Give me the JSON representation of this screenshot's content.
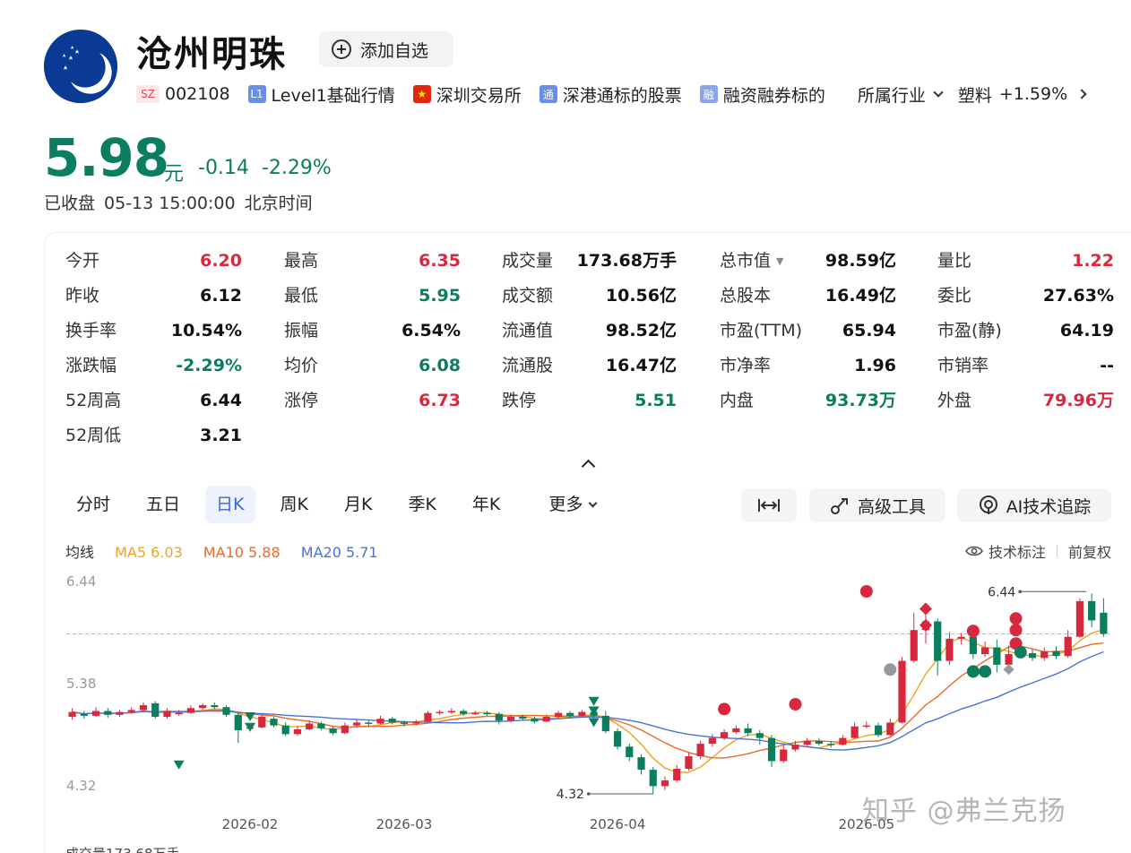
{
  "header": {
    "stock_name": "沧州明珠",
    "add_watchlist_label": "添加自选",
    "exchange_code": "SZ",
    "stock_code": "002108",
    "level_badge": "L1",
    "level_label": "Level1基础行情",
    "exchange_label": "深圳交易所",
    "connect_badge": "通",
    "connect_label": "深港通标的股票",
    "margin_badge": "融",
    "margin_label": "融资融券标的",
    "industry_label": "所属行业",
    "industry_name": "塑料",
    "industry_change": "+1.59%"
  },
  "price": {
    "current": "5.98",
    "unit": "元",
    "change": "-0.14",
    "change_pct": "-2.29%",
    "status": "已收盘",
    "datetime": "05-13 15:00:00",
    "timezone": "北京时间"
  },
  "quote_columns": [
    [
      {
        "label": "今开",
        "value": "6.20",
        "color": "up"
      },
      {
        "label": "昨收",
        "value": "6.12",
        "color": "neutral"
      },
      {
        "label": "换手率",
        "value": "10.54%",
        "color": "neutral"
      },
      {
        "label": "涨跌幅",
        "value": "-2.29%",
        "color": "down"
      },
      {
        "label": "52周高",
        "value": "6.44",
        "color": "neutral"
      },
      {
        "label": "52周低",
        "value": "3.21",
        "color": "neutral"
      }
    ],
    [
      {
        "label": "最高",
        "value": "6.35",
        "color": "up"
      },
      {
        "label": "最低",
        "value": "5.95",
        "color": "down"
      },
      {
        "label": "振幅",
        "value": "6.54%",
        "color": "neutral"
      },
      {
        "label": "均价",
        "value": "6.08",
        "color": "down"
      },
      {
        "label": "涨停",
        "value": "6.73",
        "color": "up"
      }
    ],
    [
      {
        "label": "成交量",
        "value": "173.68万手",
        "color": "neutral"
      },
      {
        "label": "成交额",
        "value": "10.56亿",
        "color": "neutral"
      },
      {
        "label": "流通值",
        "value": "98.52亿",
        "color": "neutral"
      },
      {
        "label": "流通股",
        "value": "16.47亿",
        "color": "neutral"
      },
      {
        "label": "跌停",
        "value": "5.51",
        "color": "down"
      }
    ],
    [
      {
        "label": "总市值",
        "value": "98.59亿",
        "color": "neutral",
        "triangle": true
      },
      {
        "label": "总股本",
        "value": "16.49亿",
        "color": "neutral"
      },
      {
        "label": "市盈(TTM)",
        "value": "65.94",
        "color": "neutral"
      },
      {
        "label": "市净率",
        "value": "1.96",
        "color": "neutral"
      },
      {
        "label": "内盘",
        "value": "93.73万",
        "color": "down"
      }
    ],
    [
      {
        "label": "量比",
        "value": "1.22",
        "color": "up"
      },
      {
        "label": "委比",
        "value": "27.63%",
        "color": "neutral"
      },
      {
        "label": "市盈(静)",
        "value": "64.19",
        "color": "neutral"
      },
      {
        "label": "市销率",
        "value": "--",
        "color": "neutral"
      },
      {
        "label": "外盘",
        "value": "79.96万",
        "color": "up"
      }
    ]
  ],
  "chart_tabs": {
    "items": [
      "分时",
      "五日",
      "日K",
      "周K",
      "月K",
      "季K",
      "年K"
    ],
    "active": "日K",
    "more_label": "更多"
  },
  "tools": {
    "advanced_label": "高级工具",
    "ai_label": "AI技术追踪"
  },
  "ma_legend": {
    "title": "均线",
    "ma5": "MA5 6.03",
    "ma10": "MA10 5.88",
    "ma20": "MA20 5.71"
  },
  "chart_tools": {
    "indicator_label": "技术标注",
    "adjust_label": "前复权"
  },
  "colors": {
    "up": "#d8283e",
    "down": "#0a7e5e",
    "accent": "#3966d8",
    "ma5": "#f0a31f",
    "ma10": "#ea6a27",
    "ma20": "#4b73d6"
  },
  "kline": {
    "y_ticks": [
      "6.44",
      "5.38",
      "4.32"
    ],
    "x_labels": [
      "2026-02",
      "2026-03",
      "2026-04",
      "2026-05"
    ],
    "high_marker": "6.44",
    "low_marker": "4.32",
    "ref_price": 5.98,
    "candles": [
      [
        5.12,
        5.17,
        5.21,
        5.09
      ],
      [
        5.15,
        5.13,
        5.18,
        5.1
      ],
      [
        5.13,
        5.18,
        5.22,
        5.12
      ],
      [
        5.18,
        5.14,
        5.21,
        5.11
      ],
      [
        5.14,
        5.17,
        5.19,
        5.12
      ],
      [
        5.17,
        5.19,
        5.22,
        5.15
      ],
      [
        5.19,
        5.24,
        5.27,
        5.17
      ],
      [
        5.26,
        5.12,
        5.28,
        5.1
      ],
      [
        5.12,
        5.18,
        5.21,
        5.1
      ],
      [
        5.16,
        5.16,
        5.19,
        5.13
      ],
      [
        5.16,
        5.21,
        5.24,
        5.15
      ],
      [
        5.21,
        5.24,
        5.26,
        5.19
      ],
      [
        5.24,
        5.22,
        5.27,
        5.2
      ],
      [
        5.22,
        5.14,
        5.24,
        5.12
      ],
      [
        5.14,
        4.98,
        5.16,
        4.85
      ],
      [
        5.0,
        5.01,
        5.04,
        4.97
      ],
      [
        5.01,
        5.12,
        5.15,
        5.0
      ],
      [
        5.1,
        5.03,
        5.12,
        5.01
      ],
      [
        5.03,
        4.94,
        5.06,
        4.92
      ],
      [
        4.94,
        4.99,
        5.02,
        4.92
      ],
      [
        4.99,
        5.05,
        5.08,
        4.98
      ],
      [
        5.05,
        5.0,
        5.07,
        4.98
      ],
      [
        5.0,
        4.95,
        5.02,
        4.93
      ],
      [
        4.95,
        5.03,
        5.06,
        4.94
      ],
      [
        5.03,
        5.06,
        5.09,
        5.01
      ],
      [
        5.06,
        5.05,
        5.08,
        5.02
      ],
      [
        5.05,
        5.1,
        5.13,
        5.04
      ],
      [
        5.1,
        5.06,
        5.12,
        5.04
      ],
      [
        5.06,
        5.05,
        5.08,
        5.02
      ],
      [
        5.05,
        5.07,
        5.09,
        5.03
      ],
      [
        5.07,
        5.16,
        5.18,
        5.06
      ],
      [
        5.16,
        5.17,
        5.19,
        5.14
      ],
      [
        5.17,
        5.18,
        5.21,
        5.15
      ],
      [
        5.18,
        5.15,
        5.2,
        5.13
      ],
      [
        5.15,
        5.16,
        5.18,
        5.14
      ],
      [
        5.16,
        5.15,
        5.18,
        5.13
      ],
      [
        5.15,
        5.08,
        5.17,
        5.04
      ],
      [
        5.08,
        5.12,
        5.14,
        5.06
      ],
      [
        5.12,
        5.1,
        5.14,
        5.08
      ],
      [
        5.1,
        5.07,
        5.12,
        5.05
      ],
      [
        5.07,
        5.12,
        5.14,
        5.06
      ],
      [
        5.12,
        5.16,
        5.18,
        5.1
      ],
      [
        5.16,
        5.13,
        5.18,
        5.11
      ],
      [
        5.13,
        5.17,
        5.19,
        5.12
      ],
      [
        5.17,
        5.13,
        5.19,
        5.11
      ],
      [
        5.13,
        4.97,
        5.18,
        4.95
      ],
      [
        4.97,
        4.81,
        5.0,
        4.78
      ],
      [
        4.81,
        4.7,
        4.84,
        4.66
      ],
      [
        4.7,
        4.57,
        4.73,
        4.52
      ],
      [
        4.57,
        4.4,
        4.6,
        4.32
      ],
      [
        4.4,
        4.46,
        4.5,
        4.36
      ],
      [
        4.46,
        4.58,
        4.62,
        4.44
      ],
      [
        4.58,
        4.71,
        4.75,
        4.56
      ],
      [
        4.71,
        4.84,
        4.87,
        4.68
      ],
      [
        4.84,
        4.9,
        4.94,
        4.81
      ],
      [
        4.9,
        4.96,
        4.99,
        4.88
      ],
      [
        4.96,
        5.0,
        5.03,
        4.94
      ],
      [
        5.0,
        4.95,
        5.05,
        4.92
      ],
      [
        4.95,
        4.9,
        4.98,
        4.83
      ],
      [
        4.9,
        4.66,
        4.93,
        4.6
      ],
      [
        4.66,
        4.78,
        4.82,
        4.64
      ],
      [
        4.78,
        4.83,
        4.87,
        4.76
      ],
      [
        4.83,
        4.87,
        4.9,
        4.81
      ],
      [
        4.87,
        4.84,
        4.9,
        4.82
      ],
      [
        4.84,
        4.83,
        4.87,
        4.8
      ],
      [
        4.83,
        4.9,
        4.93,
        4.82
      ],
      [
        4.9,
        5.02,
        5.06,
        4.89
      ],
      [
        5.02,
        5.03,
        5.07,
        5.0
      ],
      [
        5.03,
        4.93,
        5.06,
        4.91
      ],
      [
        4.93,
        5.06,
        5.1,
        4.92
      ],
      [
        5.06,
        5.7,
        5.74,
        5.05
      ],
      [
        5.7,
        6.02,
        6.2,
        5.68
      ],
      [
        6.02,
        6.11,
        6.2,
        5.88
      ],
      [
        6.11,
        5.7,
        6.14,
        5.55
      ],
      [
        5.7,
        5.93,
        6.0,
        5.66
      ],
      [
        5.93,
        5.95,
        5.99,
        5.87
      ],
      [
        5.95,
        5.77,
        5.99,
        5.72
      ],
      [
        5.77,
        5.84,
        5.9,
        5.74
      ],
      [
        5.84,
        5.66,
        5.92,
        5.58
      ],
      [
        5.66,
        5.77,
        5.86,
        5.64
      ],
      [
        5.77,
        5.78,
        5.82,
        5.74
      ],
      [
        5.78,
        5.73,
        5.82,
        5.7
      ],
      [
        5.73,
        5.8,
        5.84,
        5.7
      ],
      [
        5.8,
        5.75,
        5.85,
        5.72
      ],
      [
        5.75,
        5.95,
        6.02,
        5.73
      ],
      [
        5.95,
        6.32,
        6.35,
        5.94
      ],
      [
        6.32,
        6.12,
        6.4,
        6.05
      ],
      [
        6.2,
        5.98,
        6.35,
        5.95
      ]
    ]
  }
}
